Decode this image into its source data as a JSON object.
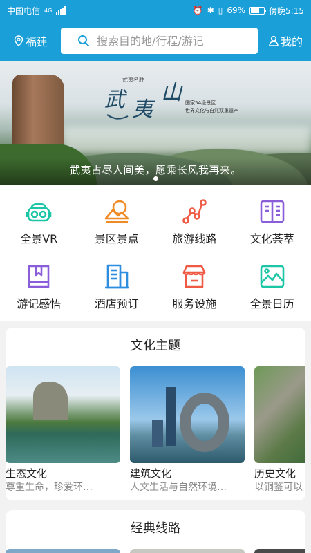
{
  "status": {
    "carrier": "中国电信",
    "network": "4G",
    "battery": "69%",
    "battery_level": 0.69,
    "time": "傍晚5:15"
  },
  "header": {
    "location": "福建",
    "search_placeholder": "搜索目的地/行程/游记",
    "me_label": "我的"
  },
  "banner": {
    "calligraphy": "武夷山",
    "stamp": "武夷名胜",
    "side_note": [
      "国家5A级景区",
      "世界文化与自然双重遗产"
    ],
    "caption": "武夷占尽人间美，愿乘长风我再来。"
  },
  "quick_nav": [
    {
      "label": "全景VR",
      "icon": "vr-headset-icon"
    },
    {
      "label": "景区景点",
      "icon": "mountain-sun-icon"
    },
    {
      "label": "旅游线路",
      "icon": "route-path-icon"
    },
    {
      "label": "文化荟萃",
      "icon": "open-book-icon"
    },
    {
      "label": "游记感悟",
      "icon": "journal-bookmark-icon"
    },
    {
      "label": "酒店预订",
      "icon": "hotel-building-icon"
    },
    {
      "label": "服务设施",
      "icon": "shop-store-icon"
    },
    {
      "label": "全景日历",
      "icon": "landscape-calendar-icon"
    }
  ],
  "culture": {
    "title": "文化主题",
    "items": [
      {
        "name": "生态文化",
        "desc": "尊重生命，珍爱环…"
      },
      {
        "name": "建筑文化",
        "desc": "人文生活与自然环境…"
      },
      {
        "name": "历史文化",
        "desc": "以铜鉴可以"
      }
    ]
  },
  "routes": {
    "title": "经典线路"
  },
  "colors": {
    "primary": "#1a9fd8",
    "icon_teal": "#1cc5a6",
    "icon_orange": "#f08a24",
    "icon_red": "#ef5a45",
    "icon_purple": "#8b5ed9",
    "icon_blue": "#2f8de0"
  }
}
